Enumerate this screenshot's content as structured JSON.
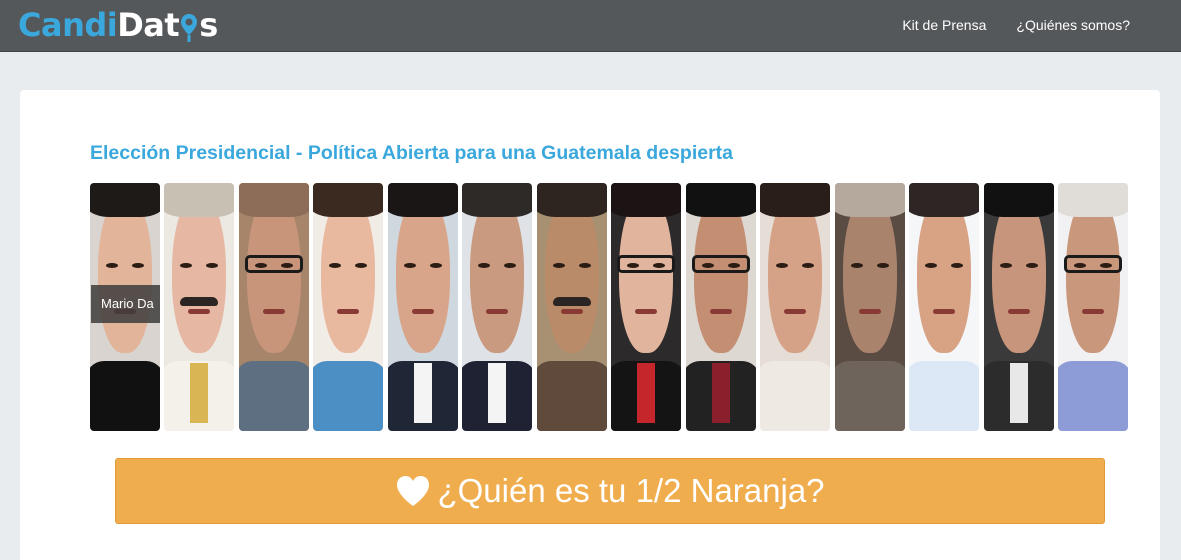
{
  "header": {
    "logo_part1": "Candi",
    "logo_part2a": "Dat",
    "logo_part2b": "s",
    "nav": [
      {
        "label": "Kit de Prensa"
      },
      {
        "label": "¿Quiénes somos?"
      }
    ]
  },
  "main": {
    "title": "Elección Presidencial - Política Abierta para una Guatemala despierta",
    "tooltip": "Mario Da",
    "candidates_count_shown": 14,
    "cta_label": "¿Quién es tu 1/2 Naranja?"
  },
  "colors": {
    "navbar": "#55585b",
    "brand_blue": "#3aa8dc",
    "cta_orange": "#f0ad4e",
    "page_bg": "#e9ecef"
  },
  "icons": {
    "logo_pin": "map-pin-icon",
    "cta_icon": "heart-icon"
  }
}
